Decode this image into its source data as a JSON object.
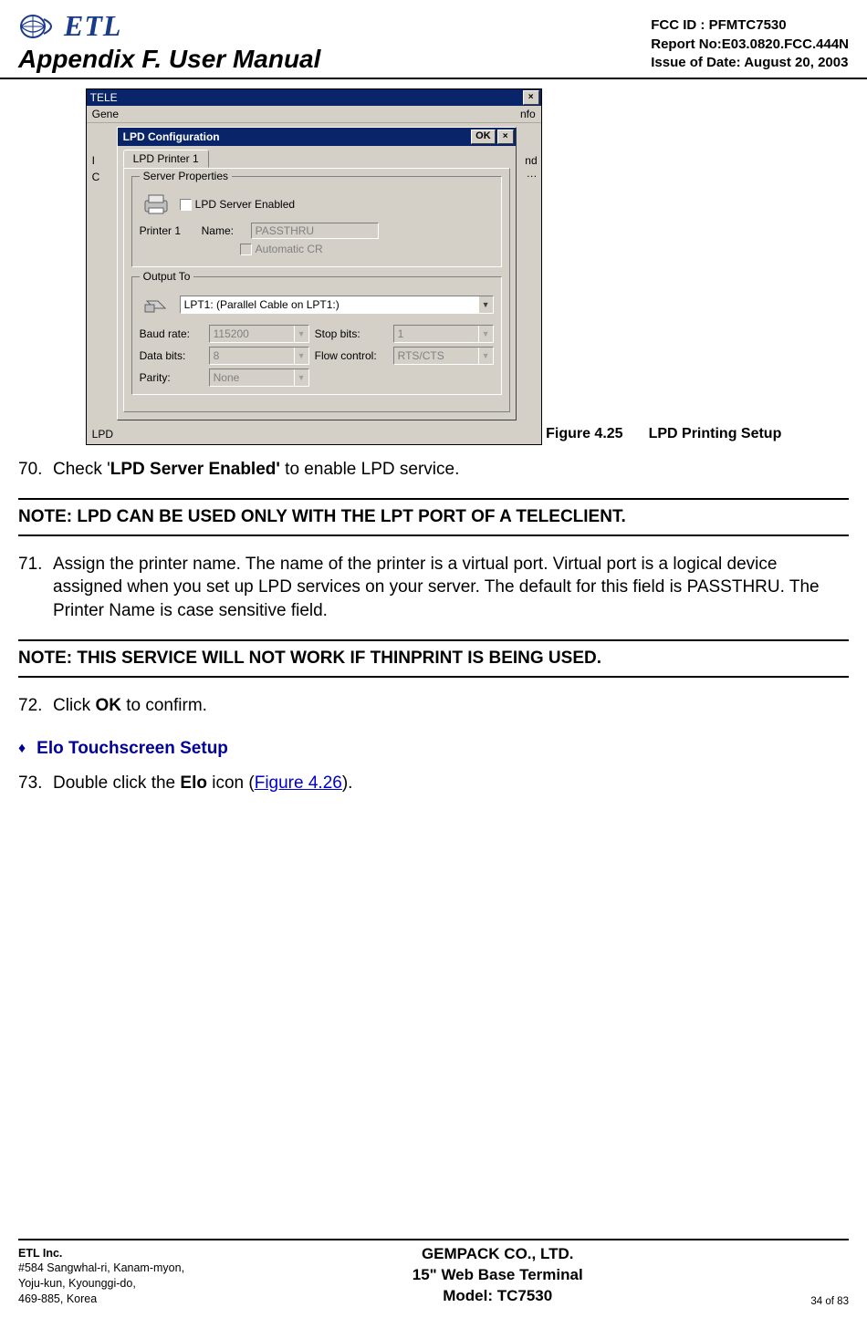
{
  "header": {
    "logo_text": "ETL",
    "appendix": "Appendix F. User Manual",
    "fcc_id": "FCC ID : PFMTC7530",
    "report_no": "Report No:E03.0820.FCC.444N",
    "issue_date": "Issue of Date: August 20, 2003"
  },
  "screenshot": {
    "bg_window_title_left": "TELE",
    "bg_window_close": "×",
    "bg_tab_left": "Gene",
    "bg_tab_right": "nfo",
    "bg_body_snip1": "I",
    "bg_body_snip2": "C",
    "bg_body_snip3": "nd",
    "bg_body_snip4": "…",
    "bg_bottom_label": "LPD",
    "dlg_title": "LPD Configuration",
    "dlg_ok": "OK",
    "dlg_close": "×",
    "tab1": "LPD Printer 1",
    "group1": "Server Properties",
    "lpd_enabled_label": "LPD Server Enabled",
    "printer_label": "Printer 1",
    "name_label": "Name:",
    "name_value": "PASSTHRU",
    "auto_cr_label": "Automatic CR",
    "group2": "Output To",
    "output_value": "LPT1: (Parallel Cable on LPT1:)",
    "baud_label": "Baud rate:",
    "baud_value": "115200",
    "data_label": "Data bits:",
    "data_value": "8",
    "parity_label": "Parity:",
    "parity_value": "None",
    "stop_label": "Stop bits:",
    "stop_value": "1",
    "flow_label": "Flow control:",
    "flow_value": "RTS/CTS"
  },
  "caption": {
    "fig_no": "Figure 4.25",
    "fig_title": "LPD Printing Setup"
  },
  "step70": {
    "num": "70.",
    "pre": "Check '",
    "bold": "LPD Server Enabled'",
    "post": " to enable LPD service."
  },
  "note1": "NOTE: LPD CAN BE USED ONLY WITH THE LPT PORT OF A TELECLIENT.",
  "step71": {
    "num": "71.",
    "text": "Assign the printer name.  The name of the printer is a virtual port.  Virtual port is a logical device assigned when you set up LPD services on your server.  The default for this field is PASSTHRU.  The Printer Name is case sensitive field."
  },
  "note2": "NOTE: THIS SERVICE WILL NOT WORK IF THINPRINT IS BEING USED.",
  "step72": {
    "num": "72.",
    "pre": "Click ",
    "bold": "OK",
    "post": " to confirm."
  },
  "section": {
    "bullet": "♦",
    "title": "Elo Touchscreen Setup"
  },
  "step73": {
    "num": "73.",
    "pre": "Double click the ",
    "bold": "Elo",
    "mid": " icon (",
    "link": "Figure 4.26",
    "post": ")."
  },
  "footer": {
    "company": "ETL Inc.",
    "addr1": "#584 Sangwhal-ri, Kanam-myon,",
    "addr2": "Yoju-kun, Kyounggi-do,",
    "addr3": "469-885, Korea",
    "center1": "GEMPACK CO., LTD.",
    "center2": "15\" Web Base Terminal",
    "center3": "Model: TC7530",
    "page": "34 of 83"
  }
}
